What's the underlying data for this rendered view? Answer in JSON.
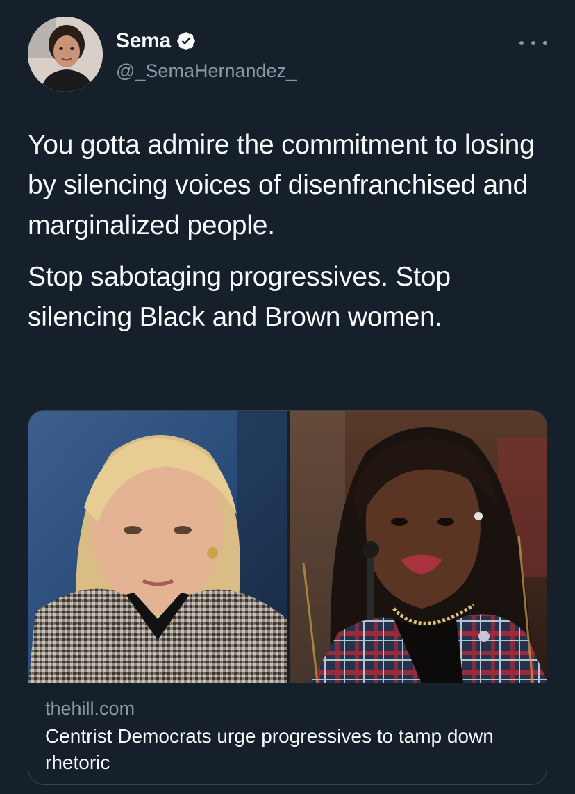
{
  "user": {
    "display_name": "Sema",
    "handle": "@_SemaHernandez_",
    "verified": true,
    "verified_color": "#f7f9f9"
  },
  "tweet": {
    "paragraphs": [
      "You gotta admire the commitment to losing by silencing voices of disenfranchised and marginalized people.",
      "Stop sabotaging progressives. Stop silencing Black and Brown women."
    ]
  },
  "card": {
    "domain": "thehill.com",
    "headline": "Centrist Democrats urge progressives to tamp down rhetoric"
  },
  "icons": {
    "verified": "verified-badge-icon",
    "more": "more-options-icon"
  },
  "colors": {
    "background": "#15202b",
    "text_primary": "#f7f9f9",
    "text_secondary": "#8b98a5",
    "border": "#38444d"
  }
}
